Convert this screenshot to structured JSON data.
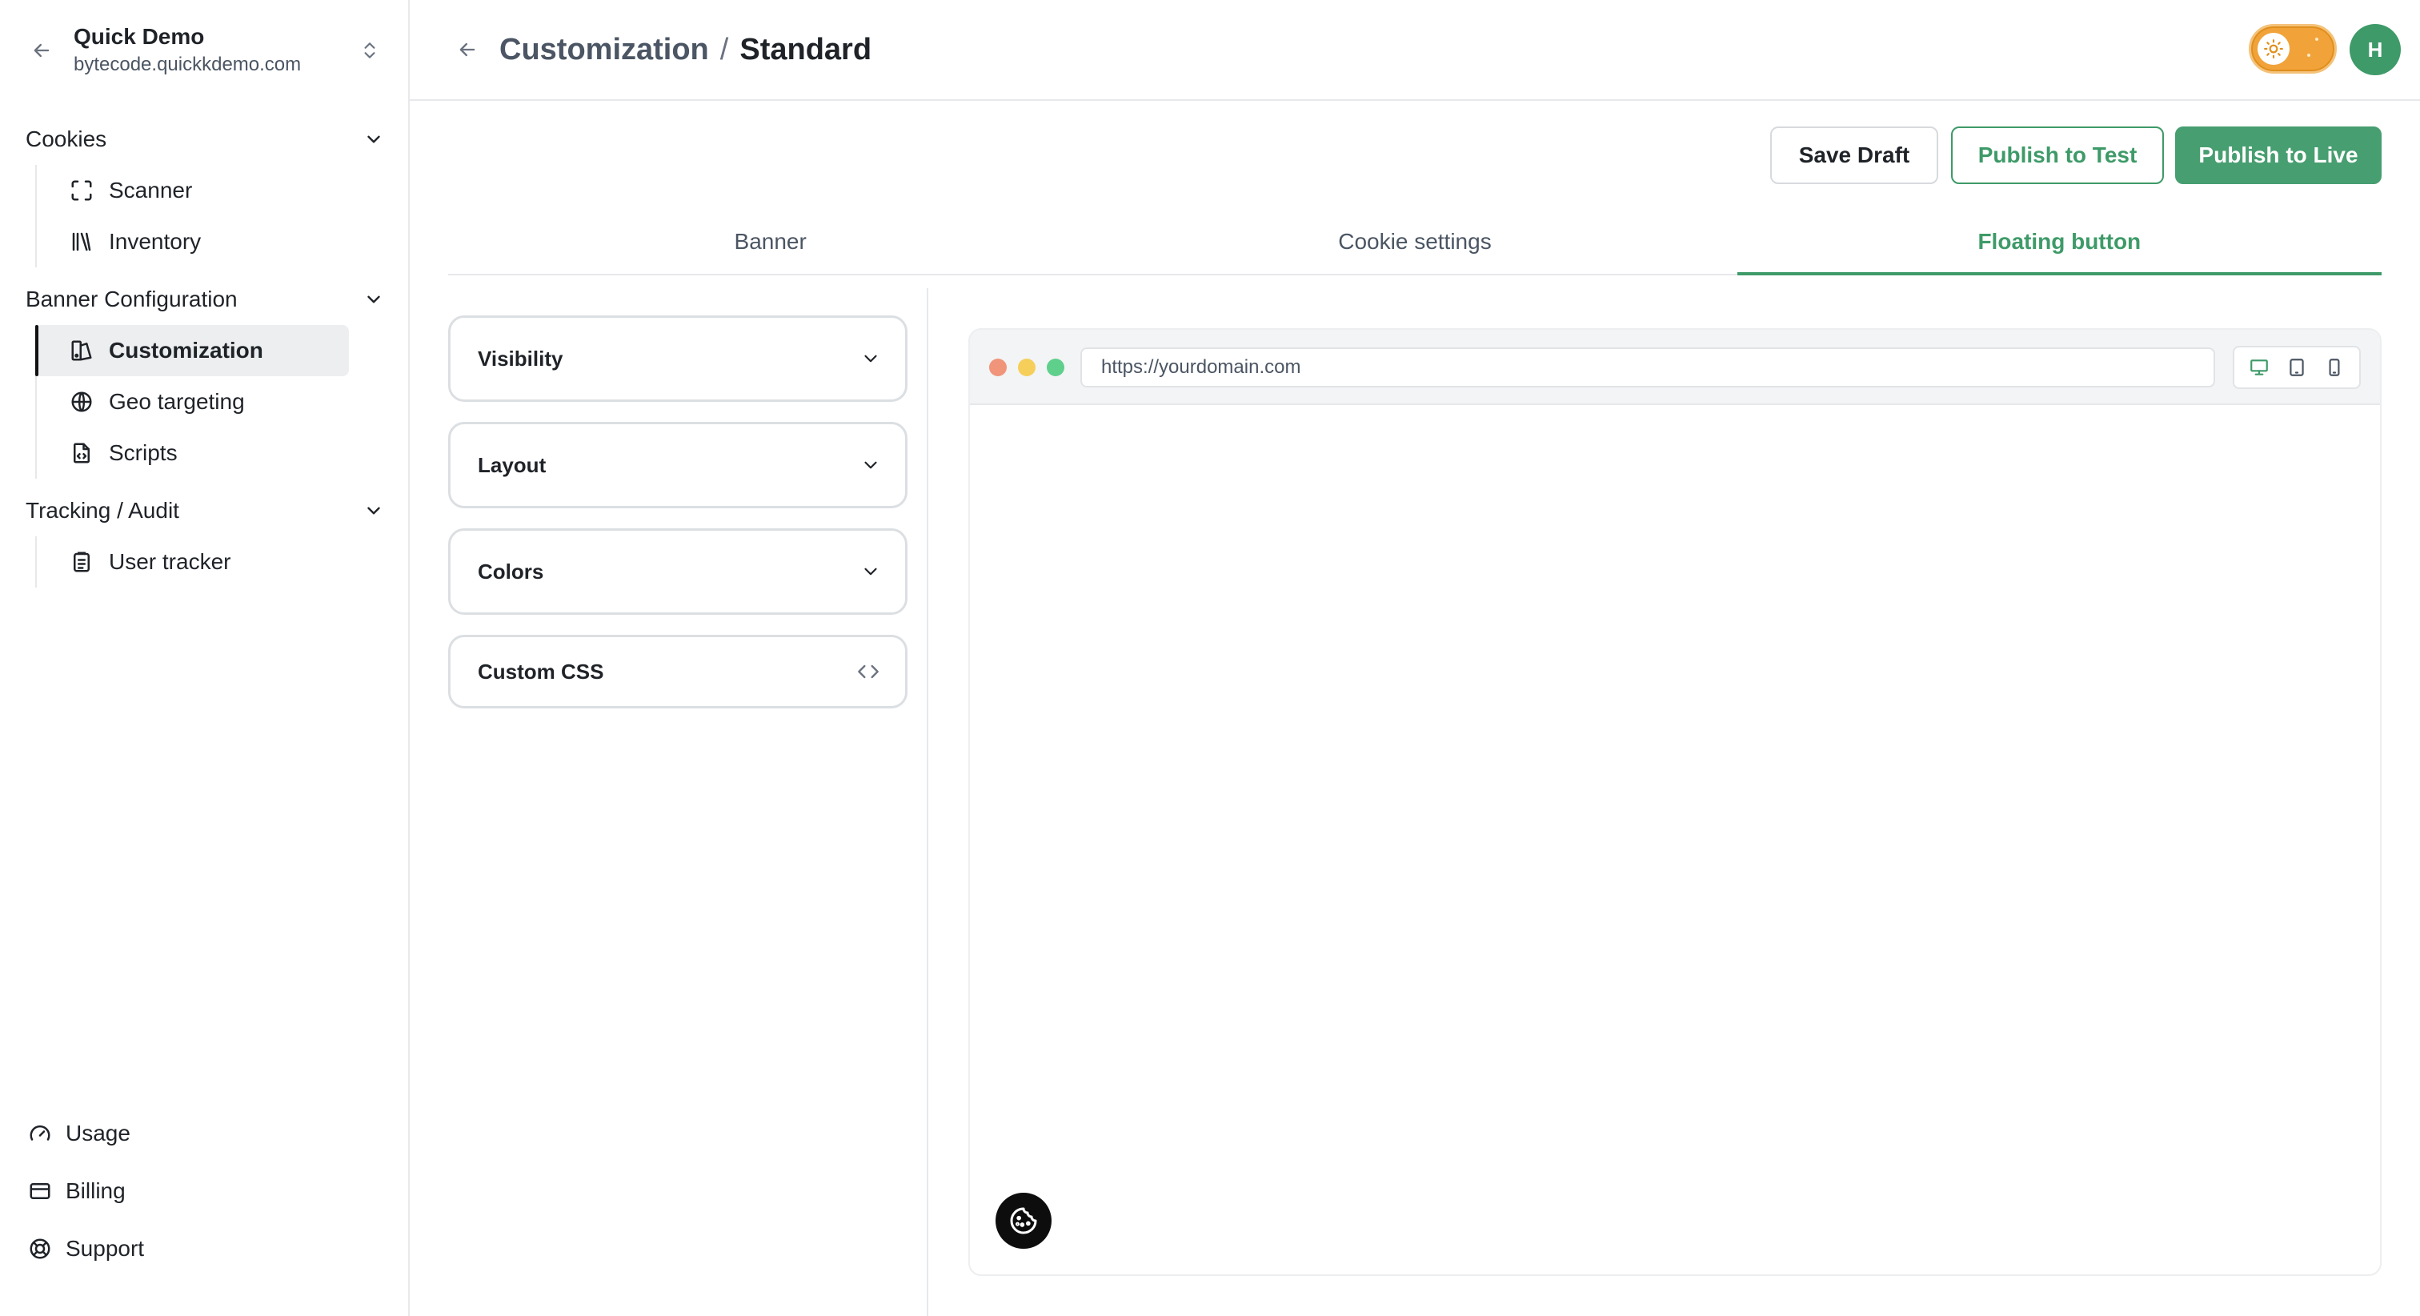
{
  "sidebar": {
    "org_name": "Quick Demo",
    "org_domain": "bytecode.quickkdemo.com",
    "groups": [
      {
        "label": "Cookies",
        "items": [
          {
            "label": "Scanner",
            "icon": "scan-icon"
          },
          {
            "label": "Inventory",
            "icon": "library-icon"
          }
        ]
      },
      {
        "label": "Banner Configuration",
        "items": [
          {
            "label": "Customization",
            "icon": "customize-icon",
            "active": true
          },
          {
            "label": "Geo targeting",
            "icon": "globe-icon"
          },
          {
            "label": "Scripts",
            "icon": "file-code-icon"
          }
        ]
      },
      {
        "label": "Tracking / Audit",
        "items": [
          {
            "label": "User tracker",
            "icon": "clipboard-icon"
          }
        ]
      }
    ],
    "bottom": [
      {
        "label": "Usage",
        "icon": "gauge-icon"
      },
      {
        "label": "Billing",
        "icon": "credit-card-icon"
      },
      {
        "label": "Support",
        "icon": "life-buoy-icon"
      }
    ]
  },
  "header": {
    "breadcrumb_parent": "Customization",
    "breadcrumb_separator": "/",
    "breadcrumb_current": "Standard",
    "avatar_initial": "H"
  },
  "actions": {
    "save_draft": "Save Draft",
    "publish_test": "Publish to Test",
    "publish_live": "Publish to Live"
  },
  "tabs": [
    {
      "label": "Banner",
      "active": false
    },
    {
      "label": "Cookie settings",
      "active": false
    },
    {
      "label": "Floating button",
      "active": true
    }
  ],
  "accordions": [
    {
      "label": "Visibility",
      "icon": "chevron-down-icon"
    },
    {
      "label": "Layout",
      "icon": "chevron-down-icon"
    },
    {
      "label": "Colors",
      "icon": "chevron-down-icon"
    },
    {
      "label": "Custom CSS",
      "icon": "code-icon"
    }
  ],
  "preview": {
    "url": "https://yourdomain.com",
    "devices": [
      "desktop-icon",
      "tablet-icon",
      "mobile-icon"
    ]
  },
  "colors": {
    "accent": "#3e9a68",
    "toggle": "#f1a33a",
    "dot_red": "#f0947a",
    "dot_yellow": "#f5cf5a",
    "dot_green": "#5fcf8c"
  }
}
